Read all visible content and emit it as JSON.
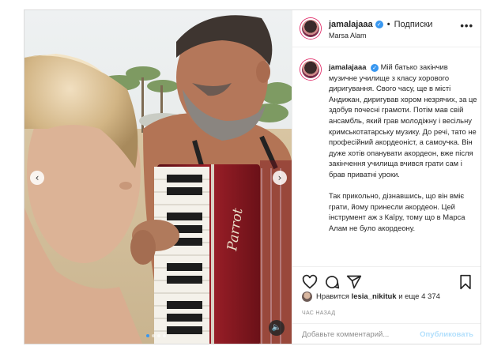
{
  "post": {
    "username": "jamalajaaa",
    "separator": "•",
    "follow_label": "Подписки",
    "location": "Marsa Alam",
    "more_label": "•••",
    "caption_paragraphs": [
      "Мій батько закінчив музичне училище з класу хорового диригування. Свого часу, ще в місті Андижан, диригував хором незрячих, за це здобув почесні грамоти. Потім мав свій ансамбль, який грав молодіжну і весільну кримськотатарську музику. До речі, тато не професійний акордеоніст, а самоучка. Він дуже хотів опанувати акордеон, вже після закінчення училища вчився грати сам і брав приватні уроки.",
      "Так прикольно, дізнавшись, що він вміє грати, йому принесли акордеон. Цей інструмент аж з Каїру, тому що в Марса Алам не було акордеону."
    ],
    "likes_prefix": "Нравится",
    "likes_user": "lesia_nikituk",
    "likes_and": "и еще",
    "likes_count": "4 374",
    "time_label": "ЧАС НАЗАД",
    "comment_placeholder": "Добавьте комментарий...",
    "publish_label": "Опубликовать"
  },
  "media": {
    "prev_icon": "‹",
    "next_icon": "›",
    "sound_icon": "🔈",
    "accordion_brand": "Parrot",
    "dot_count": 4
  },
  "colors": {
    "accent": "#3897f0",
    "publish_disabled": "#b2dffc",
    "border": "#dbdbdb",
    "text": "#262626",
    "muted": "#8e8e8e"
  }
}
